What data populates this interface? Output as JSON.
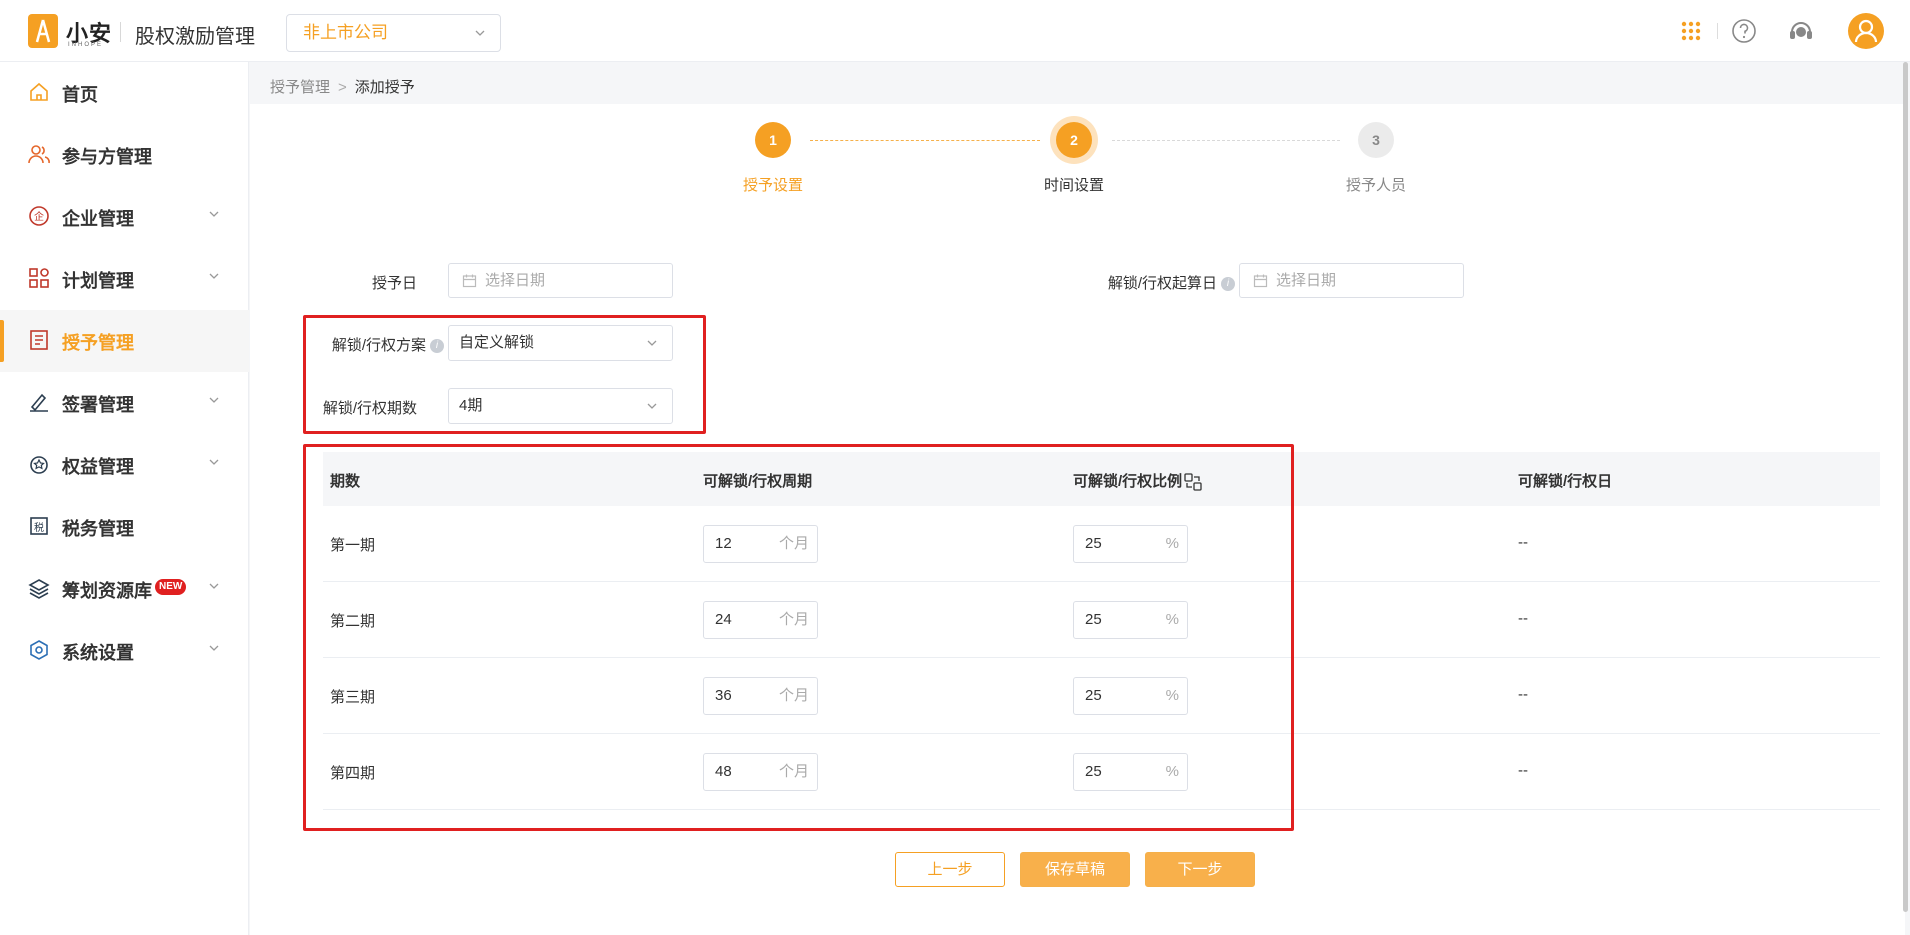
{
  "header": {
    "brand": "小安",
    "brand_sub": "INHOPE",
    "app_title": "股权激励管理",
    "company_select": "非上市公司"
  },
  "sidebar": {
    "items": [
      {
        "label": "首页"
      },
      {
        "label": "参与方管理"
      },
      {
        "label": "企业管理"
      },
      {
        "label": "计划管理"
      },
      {
        "label": "授予管理"
      },
      {
        "label": "签署管理"
      },
      {
        "label": "权益管理"
      },
      {
        "label": "税务管理"
      },
      {
        "label": "筹划资源库",
        "badge": "NEW"
      },
      {
        "label": "系统设置"
      }
    ]
  },
  "breadcrumb": {
    "parent": "授予管理",
    "current": "添加授予"
  },
  "steps": [
    {
      "num": "1",
      "label": "授予设置"
    },
    {
      "num": "2",
      "label": "时间设置"
    },
    {
      "num": "3",
      "label": "授予人员"
    }
  ],
  "form": {
    "grant_date_label": "授予日",
    "grant_date_placeholder": "选择日期",
    "unlock_start_label": "解锁/行权起算日",
    "unlock_start_placeholder": "选择日期",
    "plan_label": "解锁/行权方案",
    "plan_value": "自定义解锁",
    "periods_label": "解锁/行权期数",
    "periods_value": "4期"
  },
  "table": {
    "headers": [
      "期数",
      "可解锁/行权周期",
      "可解锁/行权比例",
      "可解锁/行权日"
    ],
    "rows": [
      {
        "period": "第一期",
        "months": "12",
        "month_unit": "个月",
        "ratio": "25",
        "ratio_unit": "%",
        "date": "--"
      },
      {
        "period": "第二期",
        "months": "24",
        "month_unit": "个月",
        "ratio": "25",
        "ratio_unit": "%",
        "date": "--"
      },
      {
        "period": "第三期",
        "months": "36",
        "month_unit": "个月",
        "ratio": "25",
        "ratio_unit": "%",
        "date": "--"
      },
      {
        "period": "第四期",
        "months": "48",
        "month_unit": "个月",
        "ratio": "25",
        "ratio_unit": "%",
        "date": "--"
      }
    ]
  },
  "buttons": {
    "prev": "上一步",
    "save_draft": "保存草稿",
    "next": "下一步"
  },
  "colors": {
    "accent": "#f5a023",
    "highlight_box": "#e02020"
  }
}
